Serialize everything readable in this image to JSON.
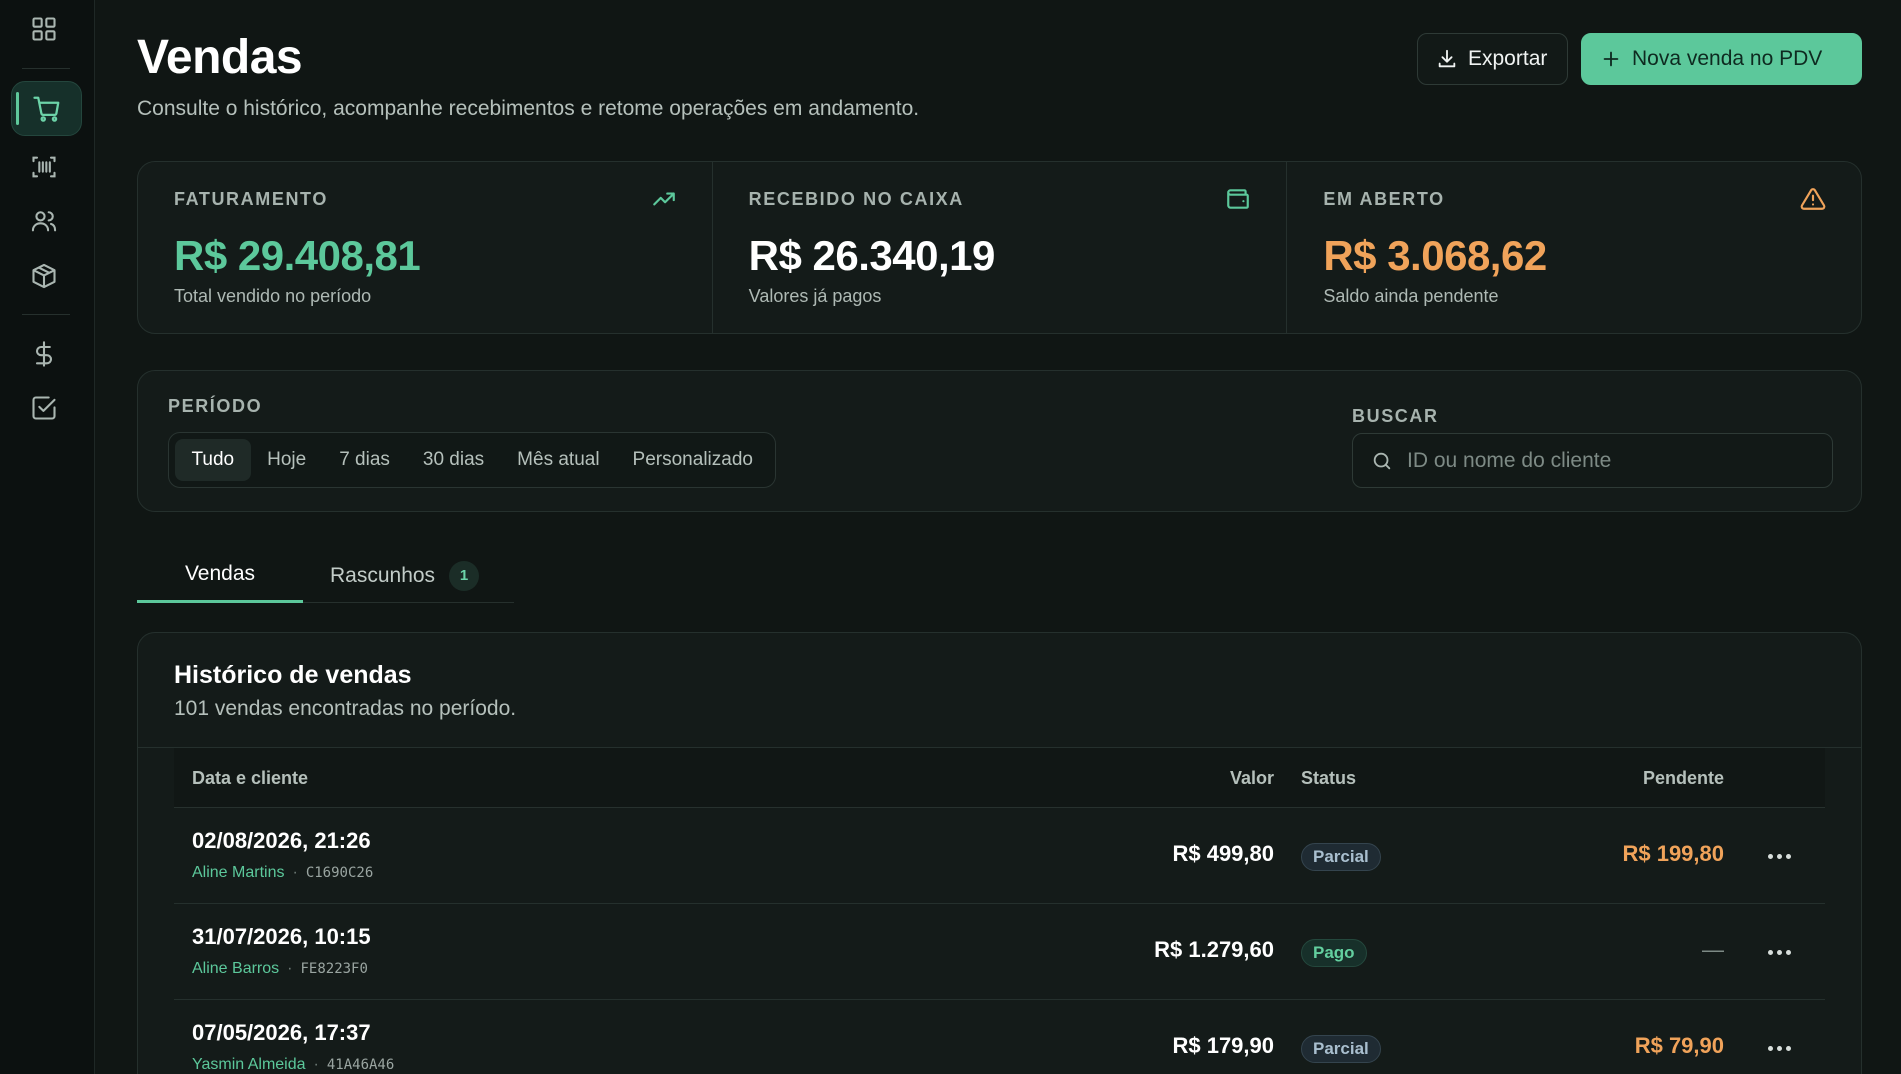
{
  "header": {
    "title": "Vendas",
    "subtitle": "Consulte o histórico, acompanhe recebimentos e retome operações em andamento.",
    "export_label": "Exportar",
    "new_sale_label": "Nova venda no PDV"
  },
  "sidebar": {
    "items": [
      {
        "icon": "dashboard-grid-icon"
      },
      {
        "icon": "shopping-cart-icon",
        "active": true
      },
      {
        "icon": "barcode-scan-icon"
      },
      {
        "icon": "users-icon"
      },
      {
        "icon": "package-box-icon"
      },
      {
        "icon": "dollar-icon"
      },
      {
        "icon": "checkbox-icon"
      }
    ]
  },
  "stats": [
    {
      "label": "FATURAMENTO",
      "value": "R$ 29.408,81",
      "caption": "Total vendido no período",
      "icon": "trending-up-icon",
      "color": "#5cc89b"
    },
    {
      "label": "RECEBIDO NO CAIXA",
      "value": "R$ 26.340,19",
      "caption": "Valores já pagos",
      "icon": "wallet-icon",
      "color": "#ffffff"
    },
    {
      "label": "EM ABERTO",
      "value": "R$ 3.068,62",
      "caption": "Saldo ainda pendente",
      "icon": "warning-triangle-icon",
      "color": "#f0a35a"
    }
  ],
  "filters": {
    "period_label": "PERÍODO",
    "periods": [
      "Tudo",
      "Hoje",
      "7 dias",
      "30 dias",
      "Mês atual",
      "Personalizado"
    ],
    "selected_period": "Tudo",
    "search_label": "BUSCAR",
    "search_placeholder": "ID ou nome do cliente"
  },
  "tabs": [
    {
      "label": "Vendas",
      "active": true
    },
    {
      "label": "Rascunhos",
      "count": "1"
    }
  ],
  "history": {
    "title": "Histórico de vendas",
    "subtitle": "101 vendas encontradas no período.",
    "columns": {
      "client": "Data e cliente",
      "value": "Valor",
      "status": "Status",
      "pending": "Pendente"
    },
    "rows": [
      {
        "date": "02/08/2026, 21:26",
        "client": "Aline Martins",
        "sep": "·",
        "id": "C1690C26",
        "value": "R$ 499,80",
        "status": "Parcial",
        "pending": "R$ 199,80"
      },
      {
        "date": "31/07/2026, 10:15",
        "client": "Aline Barros",
        "sep": "·",
        "id": "FE8223F0",
        "value": "R$ 1.279,60",
        "status": "Pago",
        "pending": "—"
      },
      {
        "date": "07/05/2026, 17:37",
        "client": "Yasmin Almeida",
        "sep": "·",
        "id": "41A46A46",
        "value": "R$ 179,90",
        "status": "Parcial",
        "pending": "R$ 79,90"
      }
    ]
  }
}
